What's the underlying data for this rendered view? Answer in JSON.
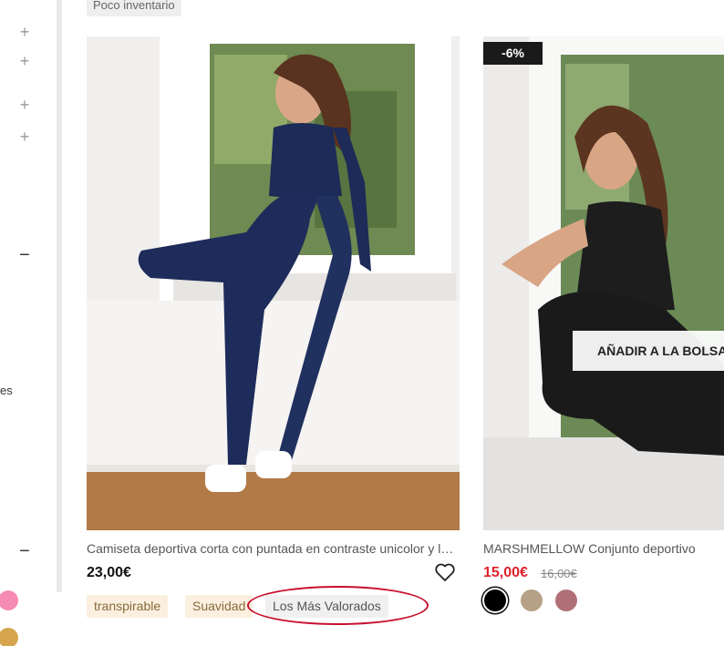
{
  "card1": {
    "top_badge": "Poco inventario",
    "title": "Camiseta deportiva corta con puntada en contraste unicolor y leggings",
    "price": "23,00€",
    "tags": [
      "transpirable",
      "Suavidad",
      "Los Más Valorados"
    ]
  },
  "card2": {
    "discount": "-6%",
    "add_to_bag": "AÑADIR A LA BOLSA",
    "title": "MARSHMELLOW Conjunto deportivo",
    "price": "15,00€",
    "old_price": "16,00€",
    "swatches": [
      "#000000",
      "#b5a185",
      "#b07077"
    ]
  },
  "sidebar": {
    "partial_label": "es",
    "color_dots": [
      "#f58bb3",
      "#d6a64f"
    ]
  }
}
